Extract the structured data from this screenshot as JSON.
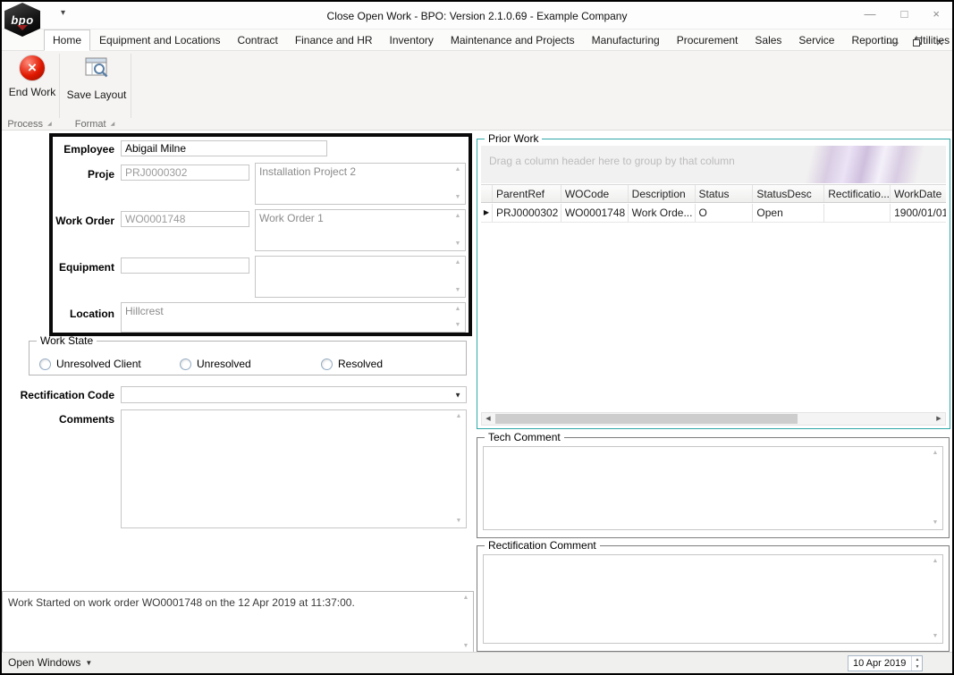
{
  "window": {
    "title": "Close Open Work - BPO: Version 2.1.0.69 - Example Company",
    "logo_text": "bpo"
  },
  "ribbon": {
    "tabs": [
      {
        "label": "Home"
      },
      {
        "label": "Equipment and Locations"
      },
      {
        "label": "Contract"
      },
      {
        "label": "Finance and HR"
      },
      {
        "label": "Inventory"
      },
      {
        "label": "Maintenance and Projects"
      },
      {
        "label": "Manufacturing"
      },
      {
        "label": "Procurement"
      },
      {
        "label": "Sales"
      },
      {
        "label": "Service"
      },
      {
        "label": "Reporting"
      },
      {
        "label": "Utilities"
      }
    ],
    "end_work_label": "End Work",
    "save_layout_label": "Save Layout",
    "process_group_label": "Process",
    "format_group_label": "Format"
  },
  "form": {
    "employee_label": "Employee",
    "employee_value": "Abigail Milne",
    "project_label": "Proje",
    "project_code": "PRJ0000302",
    "project_desc": "Installation Project 2",
    "work_order_label": "Work Order",
    "work_order_code": "WO0001748",
    "work_order_desc": "Work Order 1",
    "equipment_label": "Equipment",
    "equipment_code": "",
    "equipment_desc": "",
    "location_label": "Location",
    "location_value": "Hillcrest",
    "work_state": {
      "caption": "Work State",
      "options": [
        "Unresolved Client",
        "Unresolved",
        "Resolved"
      ]
    },
    "rectification_code_label": "Rectification Code",
    "rectification_code_value": "",
    "comments_label": "Comments",
    "comments_value": "",
    "status_message": "Work Started on work order WO0001748 on the 12 Apr 2019 at 11:37:00."
  },
  "prior_work": {
    "caption": "Prior Work",
    "group_hint": "Drag a column header here to group by that column",
    "columns": [
      "ParentRef",
      "WOCode",
      "Description",
      "Status",
      "StatusDesc",
      "Rectificatio...",
      "WorkDate"
    ],
    "rows": [
      {
        "parent_ref": "PRJ0000302",
        "wo_code": "WO0001748",
        "description": "Work Orde...",
        "status": "O",
        "status_desc": "Open",
        "rectification": "",
        "work_date": "1900/01/01"
      }
    ]
  },
  "tech_comment": {
    "caption": "Tech Comment",
    "value": ""
  },
  "rectification_comment": {
    "caption": "Rectification Comment",
    "value": ""
  },
  "status_bar": {
    "open_windows_label": "Open Windows",
    "date_value": "10 Apr 2019"
  }
}
